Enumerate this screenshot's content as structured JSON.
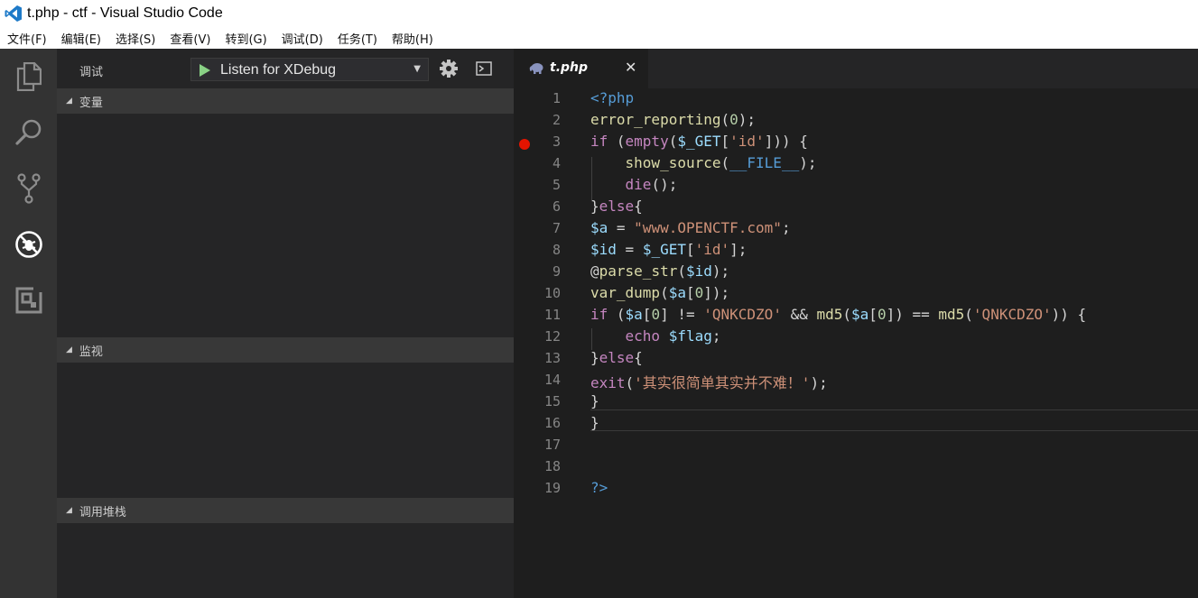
{
  "window": {
    "title": "t.php - ctf - Visual Studio Code"
  },
  "menu": [
    "文件(F)",
    "编辑(E)",
    "选择(S)",
    "查看(V)",
    "转到(G)",
    "调试(D)",
    "任务(T)",
    "帮助(H)"
  ],
  "activity_bar": [
    "explorer-icon",
    "search-icon",
    "source-control-icon",
    "debug-icon",
    "extensions-icon"
  ],
  "debug_panel": {
    "title": "调试",
    "configuration": "Listen for XDebug",
    "sections": {
      "variables": "变量",
      "watch": "监视",
      "call_stack": "调用堆栈"
    }
  },
  "editor": {
    "tab_label": "t.php",
    "close_glyph": "✕",
    "breakpoint_line": 3,
    "current_line": 16,
    "lines": [
      {
        "n": "1",
        "code": "<?php"
      },
      {
        "n": "2",
        "code": "error_reporting(0);"
      },
      {
        "n": "3",
        "code": "if (empty($_GET['id'])) {"
      },
      {
        "n": "4",
        "code": "    show_source(__FILE__);"
      },
      {
        "n": "5",
        "code": "    die();"
      },
      {
        "n": "6",
        "code": "}else{"
      },
      {
        "n": "7",
        "code": "$a = \"www.OPENCTF.com\";"
      },
      {
        "n": "8",
        "code": "$id = $_GET['id'];"
      },
      {
        "n": "9",
        "code": "@parse_str($id);"
      },
      {
        "n": "10",
        "code": "var_dump($a[0]);"
      },
      {
        "n": "11",
        "code": "if ($a[0] != 'QNKCDZO' && md5($a[0]) == md5('QNKCDZO')) {"
      },
      {
        "n": "12",
        "code": "    echo $flag;"
      },
      {
        "n": "13",
        "code": "}else{"
      },
      {
        "n": "14",
        "code": "exit('其实很简单其实并不难！');"
      },
      {
        "n": "15",
        "code": "}"
      },
      {
        "n": "16",
        "code": "}"
      },
      {
        "n": "17",
        "code": ""
      },
      {
        "n": "18",
        "code": ""
      },
      {
        "n": "19",
        "code": "?>"
      }
    ]
  },
  "colors": {
    "activity_bar": "#333333",
    "side_panel": "#252526",
    "editor_bg": "#1e1e1e",
    "breakpoint": "#e51400",
    "play_green": "#89d185"
  }
}
